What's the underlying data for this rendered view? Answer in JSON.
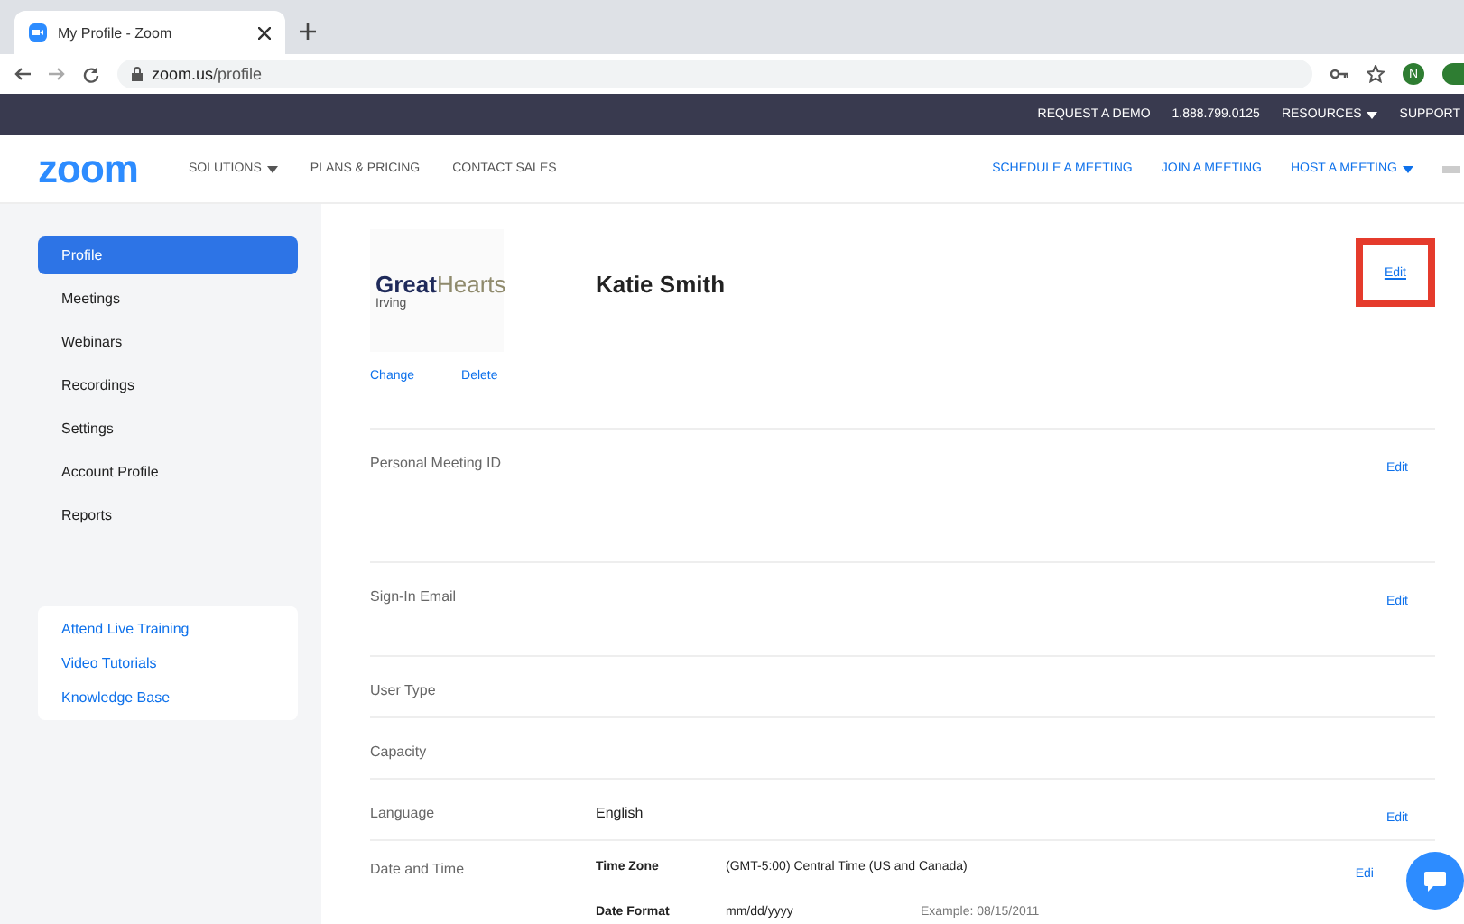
{
  "browser": {
    "tab_title": "My Profile - Zoom",
    "url_host": "zoom.us",
    "url_path": "/profile",
    "profile_initial": "N"
  },
  "top_bar": [
    {
      "label": "REQUEST A DEMO",
      "dropdown": false
    },
    {
      "label": "1.888.799.0125",
      "dropdown": false
    },
    {
      "label": "RESOURCES",
      "dropdown": true
    },
    {
      "label": "SUPPORT",
      "dropdown": false
    }
  ],
  "nav": {
    "logo": "zoom",
    "left": [
      {
        "label": "SOLUTIONS",
        "dropdown": true
      },
      {
        "label": "PLANS & PRICING",
        "dropdown": false
      },
      {
        "label": "CONTACT SALES",
        "dropdown": false
      }
    ],
    "right": [
      {
        "label": "SCHEDULE A MEETING",
        "dropdown": false
      },
      {
        "label": "JOIN A MEETING",
        "dropdown": false
      },
      {
        "label": "HOST A MEETING",
        "dropdown": true
      }
    ]
  },
  "sidebar": {
    "items": [
      {
        "label": "Profile",
        "selected": true
      },
      {
        "label": "Meetings",
        "selected": false
      },
      {
        "label": "Webinars",
        "selected": false
      },
      {
        "label": "Recordings",
        "selected": false
      },
      {
        "label": "Settings",
        "selected": false
      },
      {
        "label": "Account Profile",
        "selected": false
      },
      {
        "label": "Reports",
        "selected": false
      }
    ],
    "links": [
      "Attend Live Training",
      "Video Tutorials",
      "Knowledge Base"
    ]
  },
  "profile": {
    "name": "Katie Smith",
    "picture": {
      "word_1": "Great",
      "word_2": "Hearts",
      "subtitle": "Irving"
    },
    "change": "Change",
    "delete": "Delete",
    "edit": {
      "label": "Edit",
      "highlighted": true
    }
  },
  "rows": [
    {
      "label": "Personal Meeting ID",
      "kind": "tall",
      "edit": "Edit"
    },
    {
      "label": "Sign-In Email",
      "kind": "medium",
      "edit": "Edit"
    },
    {
      "label": "User Type",
      "kind": "short"
    },
    {
      "label": "Capacity",
      "kind": "short"
    },
    {
      "label": "Language",
      "kind": "short",
      "value": "English",
      "edit": "Edit"
    },
    {
      "label": "Date and Time",
      "kind": "details",
      "edit": "Edi",
      "details": [
        {
          "label": "Time Zone",
          "value": "(GMT-5:00) Central Time (US and Canada)"
        },
        {
          "label": "Date Format",
          "value": "mm/dd/yyyy",
          "note": "Example:  08/15/2011"
        }
      ]
    }
  ]
}
